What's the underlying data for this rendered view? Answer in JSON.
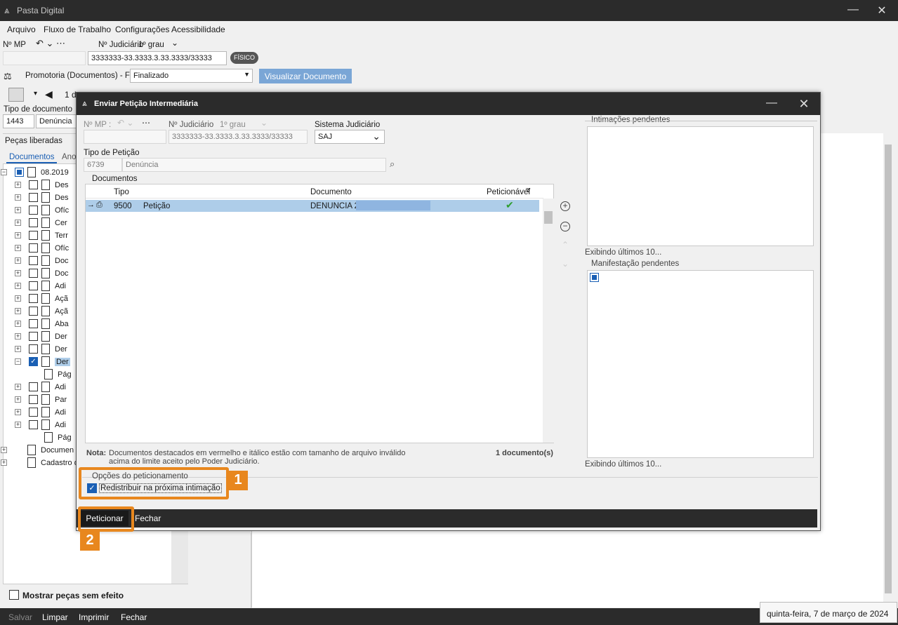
{
  "app": {
    "title": "Pasta Digital"
  },
  "menu": [
    "Arquivo",
    "Fluxo de Trabalho",
    "Configurações",
    "Acessibilidade"
  ],
  "header": {
    "mp_label": "Nº MP",
    "judicial_label": "Nº Judiciário",
    "grau": "1º grau",
    "judicial_value": "3333333-33.3333.3.33.3333/33333",
    "fisico": "FÍSICO",
    "promotoria_label": "Promotoria (Documentos) - Fila",
    "fila_value": "Finalizado",
    "visualizar_btn": "Visualizar Documento",
    "page_prefix": "1 d"
  },
  "left": {
    "tipo_label": "Tipo de documento",
    "tipo_code": "1443",
    "tipo_name": "Denúncia",
    "pecas_label": "Peças liberadas",
    "tab_docs": "Documentos",
    "tab_anot": "Ano",
    "tree": [
      {
        "label": "08.2019",
        "kind": "root"
      },
      {
        "label": "Des"
      },
      {
        "label": "Des"
      },
      {
        "label": "Ofíc"
      },
      {
        "label": "Cer"
      },
      {
        "label": "Terr"
      },
      {
        "label": "Ofíc"
      },
      {
        "label": "Doc"
      },
      {
        "label": "Doc"
      },
      {
        "label": "Adi"
      },
      {
        "label": "Açã"
      },
      {
        "label": "Açã"
      },
      {
        "label": "Aba"
      },
      {
        "label": "Der"
      },
      {
        "label": "Der"
      },
      {
        "label": "Der",
        "selected": true
      },
      {
        "label": "Pág",
        "kind": "page"
      },
      {
        "label": "Adi"
      },
      {
        "label": "Par"
      },
      {
        "label": "Adi"
      },
      {
        "label": "Adi"
      },
      {
        "label": "Pág",
        "kind": "page"
      },
      {
        "label": "Documen",
        "kind": "folder"
      },
      {
        "label": "Cadastro d",
        "kind": "folder"
      }
    ],
    "mostrar": "Mostrar peças sem efeito"
  },
  "bottom": {
    "salvar": "Salvar",
    "limpar": "Limpar",
    "imprimir": "Imprimir",
    "fechar": "Fechar",
    "date": "quinta-feira, 7 de março de 2024"
  },
  "dialog": {
    "title": "Enviar Petição Intermediária",
    "mp_label": "Nº MP :",
    "judicial_label": "Nº Judiciário",
    "grau": "1º grau",
    "judicial_value": "3333333-33.3333.3.33.3333/33333",
    "sistema_label": "Sistema Judiciário",
    "sistema_value": "SAJ",
    "tipo_label": "Tipo de Petição",
    "tipo_code": "6739",
    "tipo_name": "Denúncia",
    "docs_label": "Documentos",
    "columns": [
      "Tipo",
      "Documento",
      "Peticionável"
    ],
    "rows": [
      {
        "code": "9500",
        "tipo": "Petição",
        "documento": "DENUNCIA 2"
      }
    ],
    "nota_bold": "Nota:",
    "nota_text": "Documentos destacados em vermelho e itálico estão com tamanho de arquivo inválido acima do limite aceito pelo Poder Judiciário.",
    "count": "1 documento(s)",
    "opcoes_label": "Opções do peticionamento",
    "redistribuir": "Redistribuir na próxima intimação",
    "intimacoes": "Intimações pendentes",
    "exibindo1": "Exibindo últimos 10...",
    "manifestacao": "Manifestação pendentes",
    "exibindo2": "Exibindo últimos 10...",
    "peticionar": "Peticionar",
    "fechar": "Fechar",
    "badge1": "1",
    "badge2": "2"
  }
}
